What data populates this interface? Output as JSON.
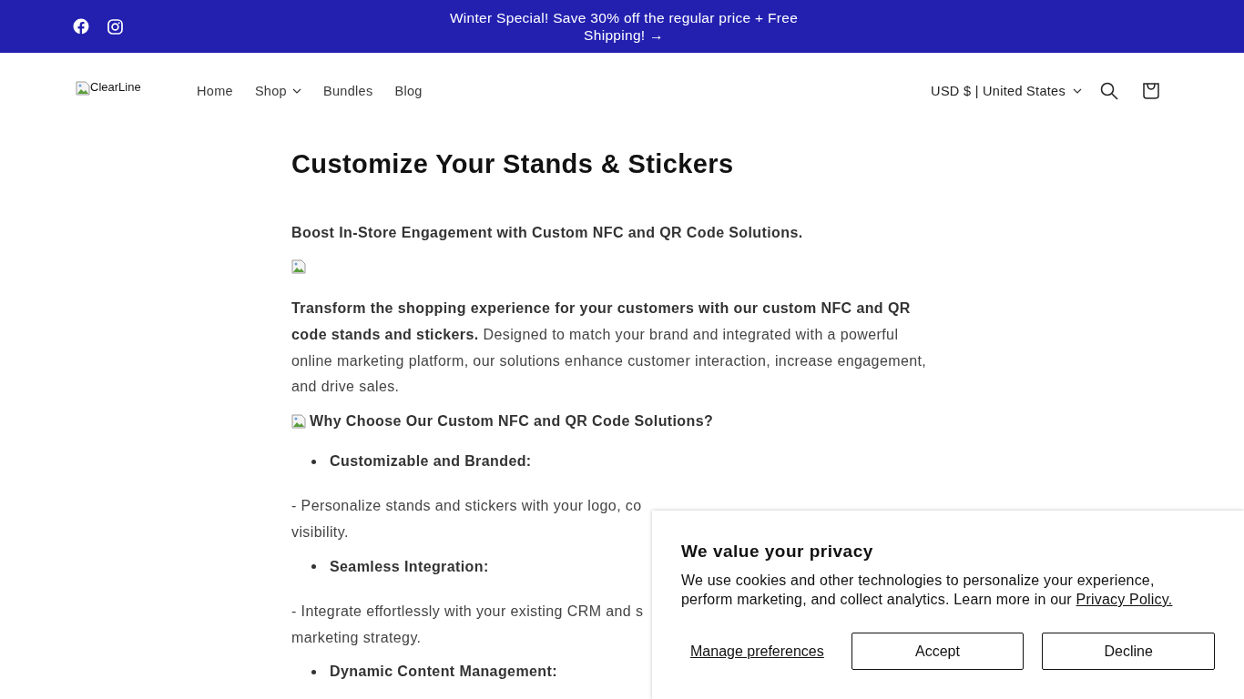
{
  "announcement": {
    "text": "Winter Special! Save 30% off the regular price + Free Shipping!",
    "arrow": "→"
  },
  "header": {
    "logo_alt": "ClearLine",
    "nav": [
      {
        "label": "Home",
        "dropdown": false
      },
      {
        "label": "Shop",
        "dropdown": true
      },
      {
        "label": "Bundles",
        "dropdown": false
      },
      {
        "label": "Blog",
        "dropdown": false
      }
    ],
    "currency": "USD $ | United States"
  },
  "content": [
    {
      "kind": "title",
      "text": "Customize Your Stands & Stickers"
    },
    {
      "kind": "lead",
      "text": "Boost In-Store Engagement with Custom NFC and QR Code Solutions."
    },
    {
      "kind": "image"
    },
    {
      "kind": "paragraph",
      "lines": [
        "**Transform the shopping experience for your customers with our custom NFC and QR code stands and stickers.** Designed to match your brand and integrated with a powerful online marketing platform, our solutions enhance customer interaction, increase engagement, and drive sales."
      ]
    },
    {
      "kind": "section",
      "text": "Why Choose Our Custom NFC and QR Code Solutions?"
    },
    {
      "kind": "bullet",
      "text": "Customizable and Branded:"
    },
    {
      "kind": "paragraph",
      "lines": [
        "- Personalize stands and stickers with your logo, co",
        "visibility."
      ]
    },
    {
      "kind": "bullet",
      "text": "Seamless Integration:"
    },
    {
      "kind": "paragraph",
      "lines": [
        "- Integrate effortlessly with your existing CRM and s",
        "marketing strategy."
      ]
    },
    {
      "kind": "bullet",
      "text": "Dynamic Content Management:"
    }
  ],
  "cookie_banner": {
    "title": "We value your privacy",
    "text": "We use cookies and other technologies to personalize your experience, perform marketing, and collect analytics. Learn more in our",
    "link": "Privacy Policy.",
    "manage": "Manage preferences",
    "buttons": [
      "Accept",
      "Decline"
    ]
  }
}
